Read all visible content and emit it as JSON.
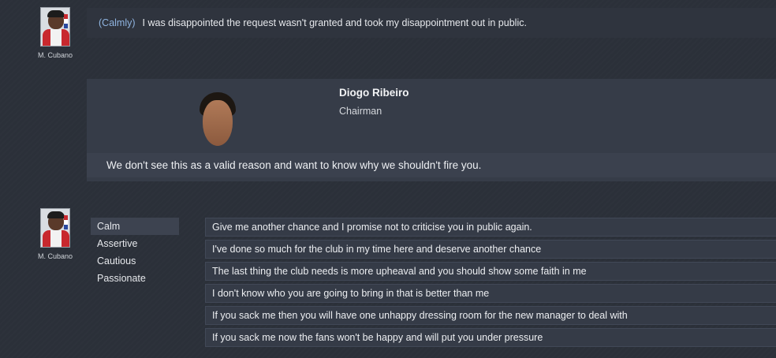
{
  "player_message": {
    "manager_name": "M. Cubano",
    "tone": "(Calmly)",
    "text": "I was disappointed the request wasn't granted and took my disappointment out in public."
  },
  "chairman": {
    "name": "Diogo Ribeiro",
    "role": "Chairman",
    "quote": "We don't see this as a valid reason and want to know why we shouldn't fire you."
  },
  "reply": {
    "manager_name": "M. Cubano",
    "tones": [
      "Calm",
      "Assertive",
      "Cautious",
      "Passionate"
    ],
    "selected_tone": "Calm",
    "options": [
      "Give me another chance and I promise not to criticise you in public again.",
      "I've done so much for the club in my time here and deserve another chance",
      "The last thing the club needs is more upheaval and you should show some faith in me",
      "I don't know who you are going to bring in that is better than me",
      "If you sack me then you will have one unhappy dressing room for the new manager to deal with",
      "If you sack me now the fans won't be happy and will put you under pressure"
    ]
  },
  "colors": {
    "background": "#2b3039",
    "tone_label": "#8fb4e0",
    "panel": "#363c48"
  }
}
